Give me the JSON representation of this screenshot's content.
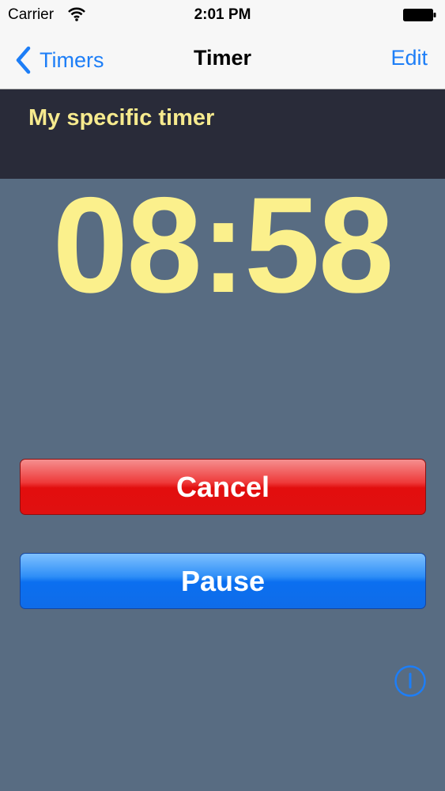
{
  "status_bar": {
    "carrier": "Carrier",
    "time": "2:01 PM",
    "wifi_icon": "wifi-icon",
    "battery_icon": "battery-icon"
  },
  "nav": {
    "back_label": "Timers",
    "title": "Timer",
    "edit_label": "Edit",
    "accent_color": "#1d7ef7"
  },
  "timer": {
    "name": "My specific timer",
    "remaining": "08:58",
    "text_color": "#fbf08c"
  },
  "actions": {
    "cancel_label": "Cancel",
    "pause_label": "Pause",
    "cancel_color": "#e20e0e",
    "pause_color": "#0b6ff0"
  },
  "info_icon": "info-icon"
}
